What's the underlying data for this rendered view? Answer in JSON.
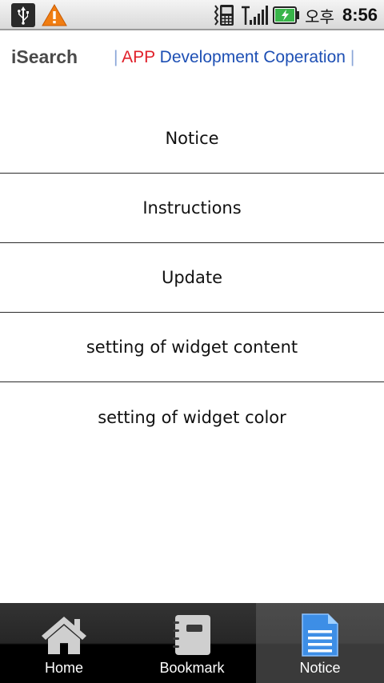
{
  "status_bar": {
    "ampm": "오후",
    "time": "8:56",
    "icons": [
      "usb-icon",
      "warning-icon",
      "phone-icon",
      "signal-icon",
      "battery-charging-icon"
    ]
  },
  "header": {
    "app_name": "iSearch",
    "tagline_app": "APP",
    "tagline_rest": "Development Coperation"
  },
  "menu": {
    "items": [
      {
        "label": "Notice"
      },
      {
        "label": "Instructions"
      },
      {
        "label": "Update"
      },
      {
        "label": "setting of widget content"
      },
      {
        "label": "setting of widget color"
      }
    ]
  },
  "tabs": [
    {
      "label": "Home",
      "icon": "home-icon"
    },
    {
      "label": "Bookmark",
      "icon": "bookmark-icon"
    },
    {
      "label": "Notice",
      "icon": "notice-icon",
      "active": true
    }
  ],
  "colors": {
    "tagline_app": "#e0202a",
    "tagline_rest": "#1d4fb4",
    "active_icon": "#3d8ee6"
  }
}
